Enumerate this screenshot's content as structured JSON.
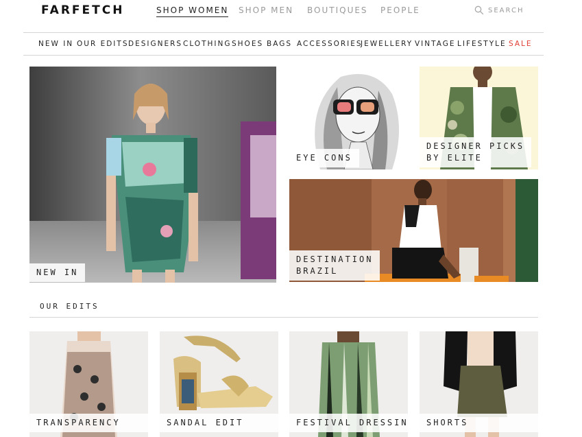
{
  "header": {
    "logo": "FARFETCH",
    "nav": [
      {
        "label": "SHOP WOMEN",
        "active": true
      },
      {
        "label": "SHOP MEN",
        "active": false
      },
      {
        "label": "BOUTIQUES",
        "active": false
      },
      {
        "label": "PEOPLE",
        "active": false
      }
    ],
    "search_label": "SEARCH",
    "search_icon": "search-icon"
  },
  "categories": [
    {
      "label": "NEW IN"
    },
    {
      "label": "OUR EDITS"
    },
    {
      "label": "DESIGNERS"
    },
    {
      "label": "CLOTHING"
    },
    {
      "label": "SHOES"
    },
    {
      "label": "BAGS"
    },
    {
      "label": "ACCESSORIES"
    },
    {
      "label": "JEWELLERY"
    },
    {
      "label": "VINTAGE"
    },
    {
      "label": "LIFESTYLE"
    },
    {
      "label": "SALE",
      "highlight": true
    }
  ],
  "features": {
    "new_in": "NEW IN",
    "eye_cons": "EYE CONS",
    "designer_picks_1": "DESIGNER PICKS",
    "designer_picks_2": "BY ELITE",
    "destination_1": "DESTINATION",
    "destination_2": "BRAZIL"
  },
  "our_edits": {
    "title": "OUR EDITS",
    "items": [
      {
        "label": "TRANSPARENCY"
      },
      {
        "label": "SANDAL EDIT"
      },
      {
        "label": "FESTIVAL DRESSING"
      },
      {
        "label": "SHORTS"
      }
    ]
  },
  "colors": {
    "sale": "#e03c31",
    "muted_nav": "#9a9a9a",
    "text": "#222222"
  }
}
